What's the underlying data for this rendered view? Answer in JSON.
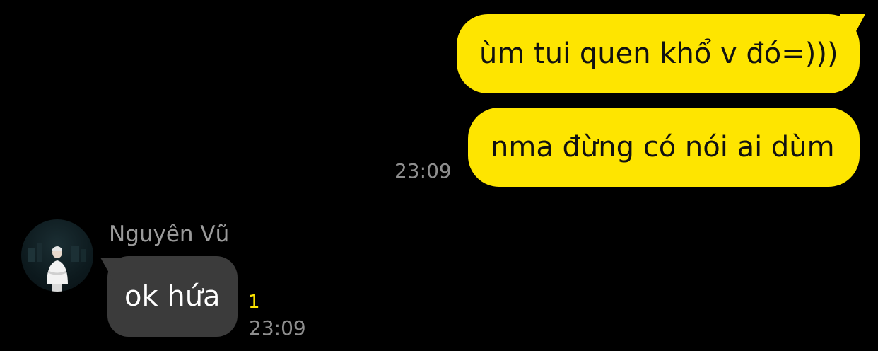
{
  "theme": {
    "background": "#000000",
    "outgoing_bubble": "#FEE500",
    "incoming_bubble": "#3B3B3B",
    "unread_color": "#FEE500"
  },
  "outgoing": {
    "messages": [
      {
        "text": "ùm tui quen khổ v đó=)))"
      },
      {
        "text": "nma đừng có nói ai dùm"
      }
    ],
    "time": "23:09"
  },
  "incoming": {
    "sender": "Nguyên Vũ",
    "avatar_icon": "profile-photo-icon",
    "messages": [
      {
        "text": "ok hứa",
        "unread": "1",
        "time": "23:09"
      }
    ]
  }
}
